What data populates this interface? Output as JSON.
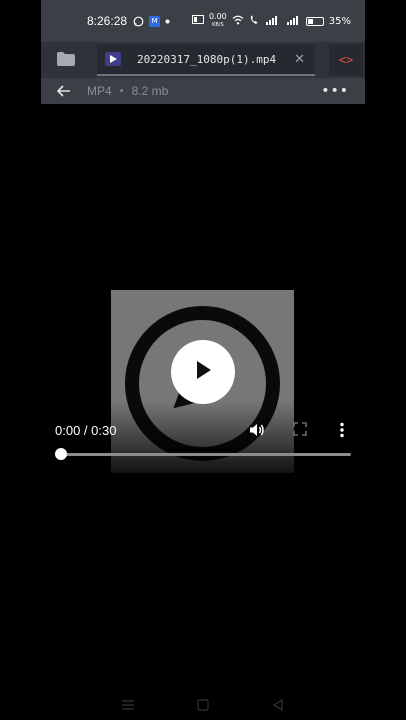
{
  "status_bar": {
    "time": "8:26:28",
    "net_speed_value": "0.00",
    "net_speed_unit": "KB/S",
    "battery": "35%",
    "battery_level": 0.35,
    "app_badge": "M"
  },
  "tabs": {
    "active_title": "20220317_1080p(1).mp4",
    "close_glyph": "✕",
    "code_glyph": "<>"
  },
  "file_info": {
    "type": "MP4",
    "separator": "•",
    "size": "8.2 mb",
    "more_glyph": "•••"
  },
  "player": {
    "current_time": "0:00",
    "duration": "0:30",
    "time_display": "0:00 / 0:30",
    "progress": 0.0
  },
  "icons": {
    "status": [
      "whatsapp-icon",
      "app-icon",
      "wifi-icon",
      "call-icon",
      "signal-icon",
      "battery-icon"
    ],
    "player": [
      "play-icon",
      "volume-icon",
      "fullscreen-icon",
      "more-vertical-icon"
    ],
    "nav": [
      "menu-icon",
      "home-icon",
      "back-triangle-icon"
    ]
  },
  "colors": {
    "status_bg": "#3b3f46",
    "tabbar_bg": "#2f3238",
    "video_bg": "#777777",
    "code_accent": "#e0503e",
    "file_icon": "#3e3f88"
  }
}
